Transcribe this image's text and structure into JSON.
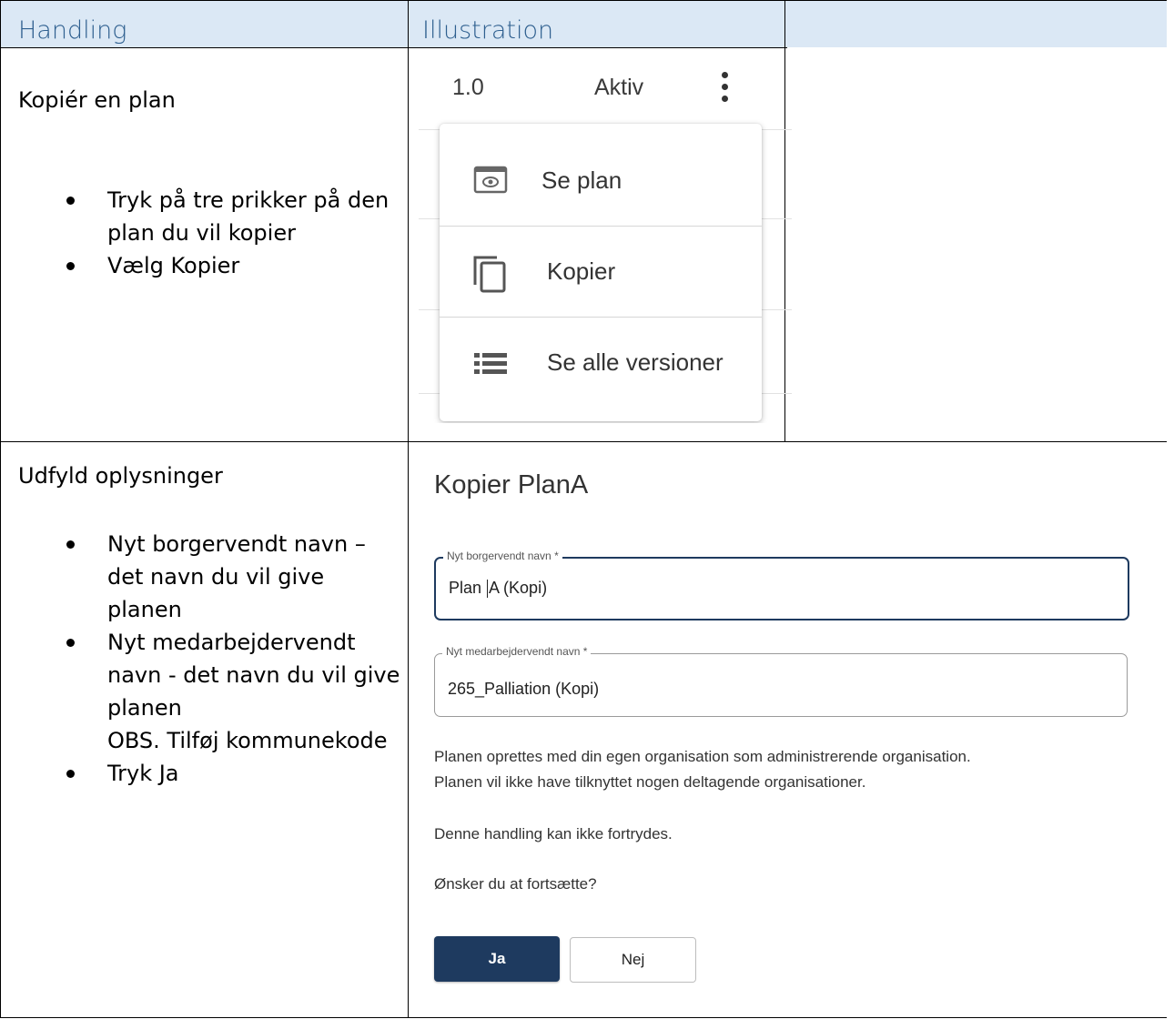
{
  "table": {
    "headers": [
      "Handling",
      "Illustration"
    ]
  },
  "row1": {
    "title": "Kopiér en plan",
    "bullets": [
      {
        "lines": [
          "Tryk på tre prikker på den",
          "plan du vil kopier"
        ]
      },
      {
        "lines": [
          "Vælg Kopier"
        ]
      }
    ],
    "illustration": {
      "version": "1.0",
      "status": "Aktiv",
      "menu_items": [
        {
          "label": "Se plan",
          "icon": "eye-icon"
        },
        {
          "label": "Kopier",
          "icon": "copy-icon"
        },
        {
          "label": "Se alle versioner",
          "icon": "list-icon"
        }
      ]
    }
  },
  "row2": {
    "title": "Udfyld oplysninger",
    "bullets": [
      {
        "lines": [
          "Nyt borgervendt navn –",
          "det navn du vil give",
          "planen"
        ]
      },
      {
        "lines": [
          "Nyt medarbejdervendt",
          "navn - det navn du vil give",
          "planen",
          "OBS. Tilføj kommunekode"
        ]
      },
      {
        "lines": [
          "Tryk Ja"
        ]
      }
    ],
    "dialog": {
      "title": "Kopier PlanA",
      "field1": {
        "label": "Nyt borgervendt navn *",
        "value_before_caret": "Plan ",
        "value_after_caret": "A (Kopi)"
      },
      "field2": {
        "label": "Nyt medarbejdervendt navn *",
        "value": "265_Palliation (Kopi)"
      },
      "info_line1": "Planen oprettes med din egen organisation som administrerende organisation.",
      "info_line2": "Planen vil ikke have tilknyttet nogen deltagende organisationer.",
      "warning": "Denne handling kan ikke fortrydes.",
      "question": "Ønsker du at fortsætte?",
      "yes_label": "Ja",
      "no_label": "Nej"
    }
  },
  "colors": {
    "header_bg": "#dbe8f5",
    "header_text": "#2e5f8f",
    "primary_button": "#1e3a5f"
  }
}
